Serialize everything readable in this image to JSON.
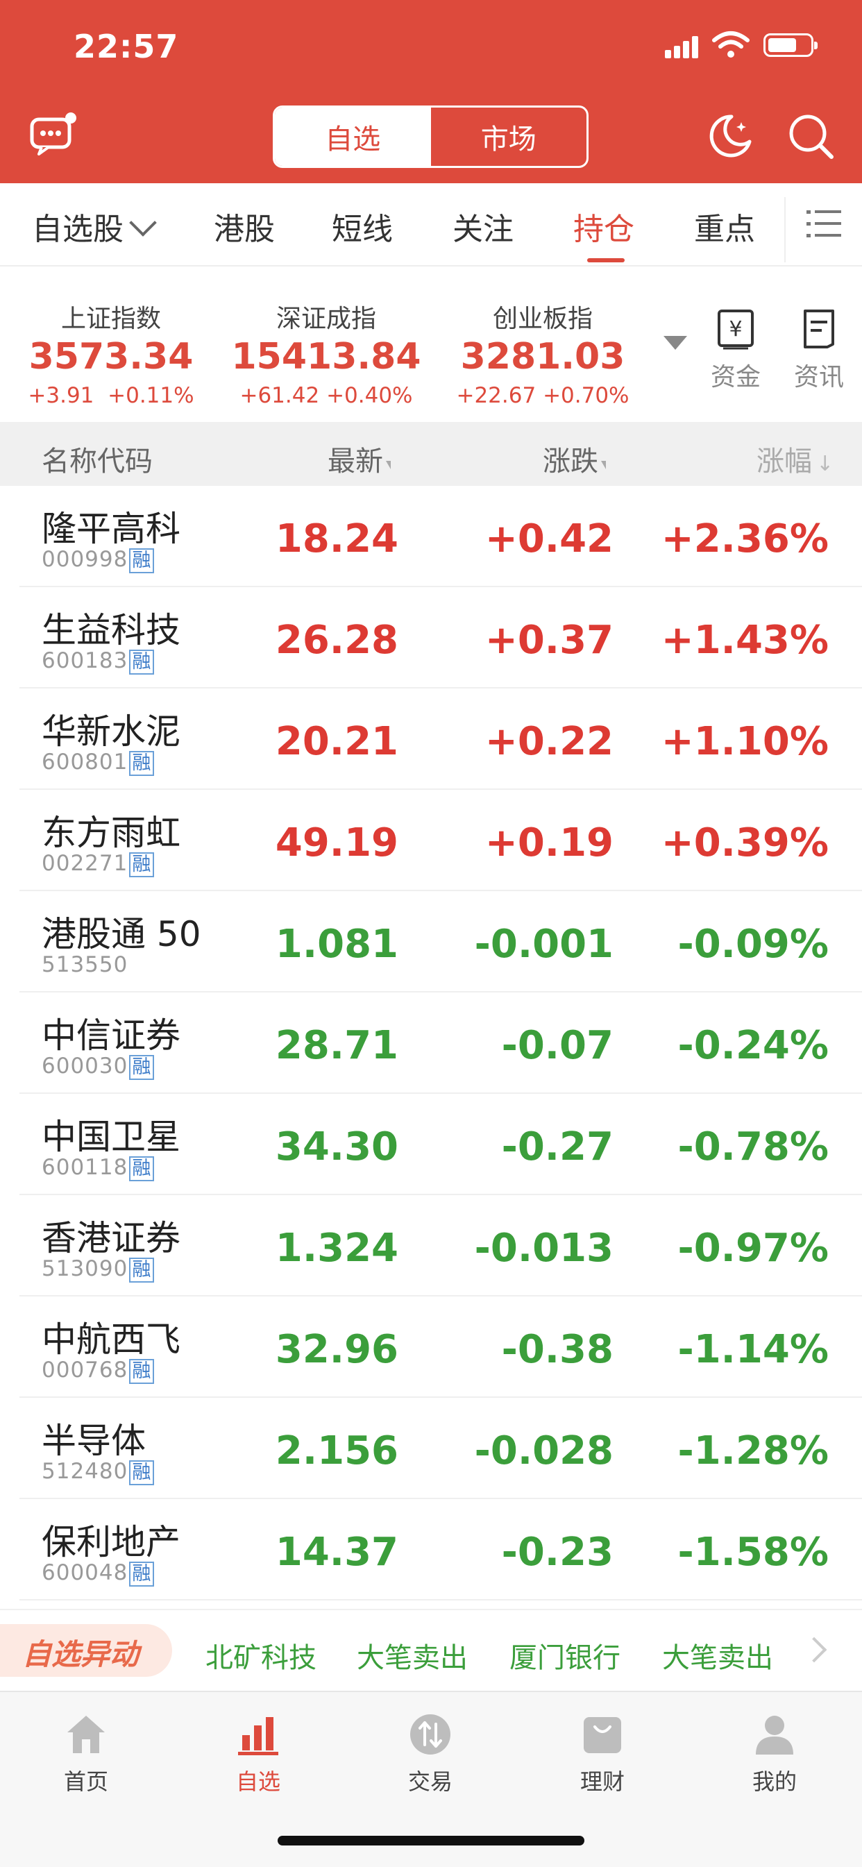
{
  "status_bar": {
    "time": "22:57"
  },
  "header": {
    "segment": {
      "active": "自选",
      "inactive": "市场"
    },
    "colors": {
      "brand": "#dd4a3c",
      "up": "#dd3a33",
      "down": "#3b9e3b"
    }
  },
  "tabs": [
    {
      "label": "自选股"
    },
    {
      "label": "港股"
    },
    {
      "label": "短线"
    },
    {
      "label": "关注"
    },
    {
      "label": "持仓"
    },
    {
      "label": "重点"
    }
  ],
  "active_tab": "持仓",
  "indices": [
    {
      "name": "上证指数",
      "value": "3573.34",
      "change": "+3.91",
      "pct": "+0.11%"
    },
    {
      "name": "深证成指",
      "value": "15413.84",
      "change": "+61.42",
      "pct": "+0.40%"
    },
    {
      "name": "创业板指",
      "value": "3281.03",
      "change": "+22.67",
      "pct": "+0.70%"
    }
  ],
  "side_buttons": {
    "funds": "资金",
    "news": "资讯",
    "funds_icon_char": "¥"
  },
  "table": {
    "headers": {
      "name": "名称代码",
      "price": "最新",
      "change": "涨跌",
      "pct": "涨幅"
    },
    "margin_tag": "融",
    "rows": [
      {
        "name": "隆平高科",
        "code": "000998",
        "margin": true,
        "price": "18.24",
        "change": "+0.42",
        "pct": "+2.36%",
        "trend": "up"
      },
      {
        "name": "生益科技",
        "code": "600183",
        "margin": true,
        "price": "26.28",
        "change": "+0.37",
        "pct": "+1.43%",
        "trend": "up"
      },
      {
        "name": "华新水泥",
        "code": "600801",
        "margin": true,
        "price": "20.21",
        "change": "+0.22",
        "pct": "+1.10%",
        "trend": "up"
      },
      {
        "name": "东方雨虹",
        "code": "002271",
        "margin": true,
        "price": "49.19",
        "change": "+0.19",
        "pct": "+0.39%",
        "trend": "up"
      },
      {
        "name": "港股通 50",
        "code": "513550",
        "margin": false,
        "price": "1.081",
        "change": "-0.001",
        "pct": "-0.09%",
        "trend": "down"
      },
      {
        "name": "中信证券",
        "code": "600030",
        "margin": true,
        "price": "28.71",
        "change": "-0.07",
        "pct": "-0.24%",
        "trend": "down"
      },
      {
        "name": "中国卫星",
        "code": "600118",
        "margin": true,
        "price": "34.30",
        "change": "-0.27",
        "pct": "-0.78%",
        "trend": "down"
      },
      {
        "name": "香港证券",
        "code": "513090",
        "margin": true,
        "price": "1.324",
        "change": "-0.013",
        "pct": "-0.97%",
        "trend": "down"
      },
      {
        "name": "中航西飞",
        "code": "000768",
        "margin": true,
        "price": "32.96",
        "change": "-0.38",
        "pct": "-1.14%",
        "trend": "down"
      },
      {
        "name": "半导体",
        "code": "512480",
        "margin": true,
        "price": "2.156",
        "change": "-0.028",
        "pct": "-1.28%",
        "trend": "down"
      },
      {
        "name": "保利地产",
        "code": "600048",
        "margin": true,
        "price": "14.37",
        "change": "-0.23",
        "pct": "-1.58%",
        "trend": "down"
      }
    ]
  },
  "ticker": {
    "badge": "自选异动",
    "items": [
      "北矿科技",
      "大笔卖出",
      "厦门银行",
      "大笔卖出"
    ]
  },
  "tabbar": [
    {
      "label": "首页",
      "icon": "home-icon"
    },
    {
      "label": "自选",
      "icon": "bar-chart-icon"
    },
    {
      "label": "交易",
      "icon": "trade-icon"
    },
    {
      "label": "理财",
      "icon": "wealth-bag-icon"
    },
    {
      "label": "我的",
      "icon": "profile-icon"
    }
  ]
}
